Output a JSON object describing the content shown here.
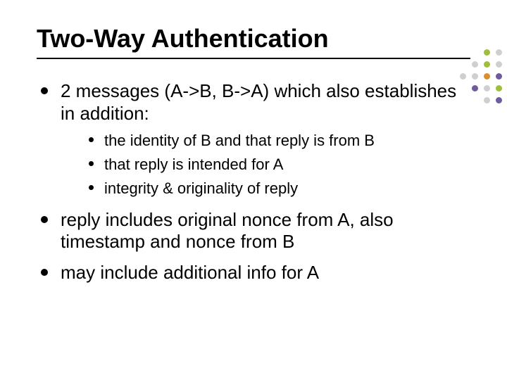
{
  "title": "Two-Way Authentication",
  "bullets": {
    "b1": "2 messages (A->B, B->A) which also establishes in addition:",
    "b1_sub": {
      "s1": "the identity of B and that reply is from B",
      "s2": "that reply is intended for A",
      "s3": "integrity & originality of reply"
    },
    "b2": "reply includes original nonce from A, also timestamp and nonce from B",
    "b3": "may include additional info for A"
  }
}
